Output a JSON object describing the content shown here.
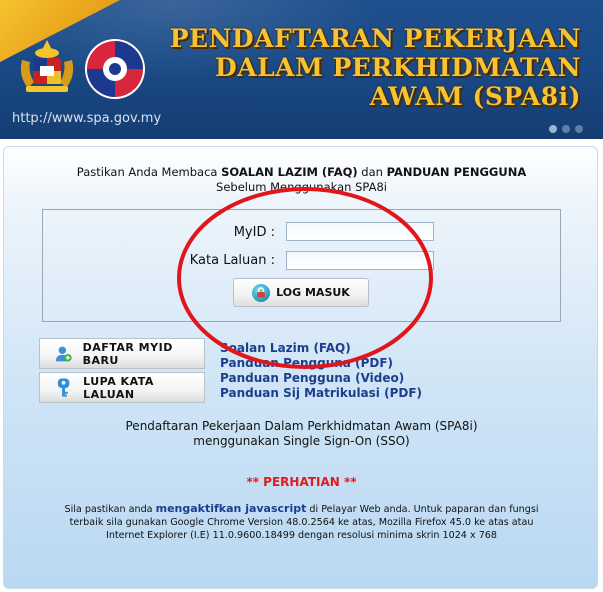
{
  "header": {
    "title_line1": "PENDAFTARAN PEKERJAAN",
    "title_line2": "DALAM PERKHIDMATAN",
    "title_line3": "AWAM (SPA8i)",
    "url": "http://www.spa.gov.my"
  },
  "intro": {
    "prefix": "Pastikan Anda Membaca ",
    "faq": "SOALAN LAZIM (FAQ)",
    "and": " dan ",
    "guide": "PANDUAN PENGGUNA",
    "line2": "Sebelum Menggunakan SPA8i"
  },
  "login": {
    "myid_label": "MyID :",
    "password_label": "Kata Laluan :",
    "myid_value": "",
    "password_value": "",
    "submit_label": "LOG MASUK"
  },
  "side_buttons": {
    "register_label": "DAFTAR MYID BARU",
    "forgot_label": "LUPA KATA LALUAN"
  },
  "links": {
    "faq": "Soalan Lazim (FAQ)",
    "guide_pdf": "Panduan Pengguna (PDF)",
    "guide_video": "Panduan Pengguna (Video)",
    "matric_pdf": "Panduan Sij Matrikulasi (PDF)"
  },
  "sso": {
    "line1": "Pendaftaran Pekerjaan Dalam Perkhidmatan Awam (SPA8i)",
    "line2": "menggunakan Single Sign-On (SSO)"
  },
  "notice": {
    "heading": "** PERHATIAN **",
    "p1a": "Sila pastikan anda ",
    "p1b": "mengaktifkan javascript",
    "p1c": " di Pelayar Web anda. Untuk paparan dan fungsi",
    "p2": "terbaik sila gunakan Google Chrome Version 48.0.2564 ke atas, Mozilla Firefox 45.0 ke atas atau",
    "p3": "Internet Explorer (I.E) 11.0.9600.18499 dengan resolusi minima skrin 1024 x 768"
  },
  "colors": {
    "banner": "#1a4a86",
    "title_gold": "#f7c332",
    "link_blue": "#1b3f8c",
    "warning_red": "#e21b1b",
    "annotation_red": "#e0161b"
  },
  "icons": {
    "crest": "malaysia-coat-of-arms-icon",
    "spa_logo": "spa-logo-icon",
    "lock": "lock-icon",
    "user_add": "user-add-icon",
    "key": "key-icon"
  }
}
